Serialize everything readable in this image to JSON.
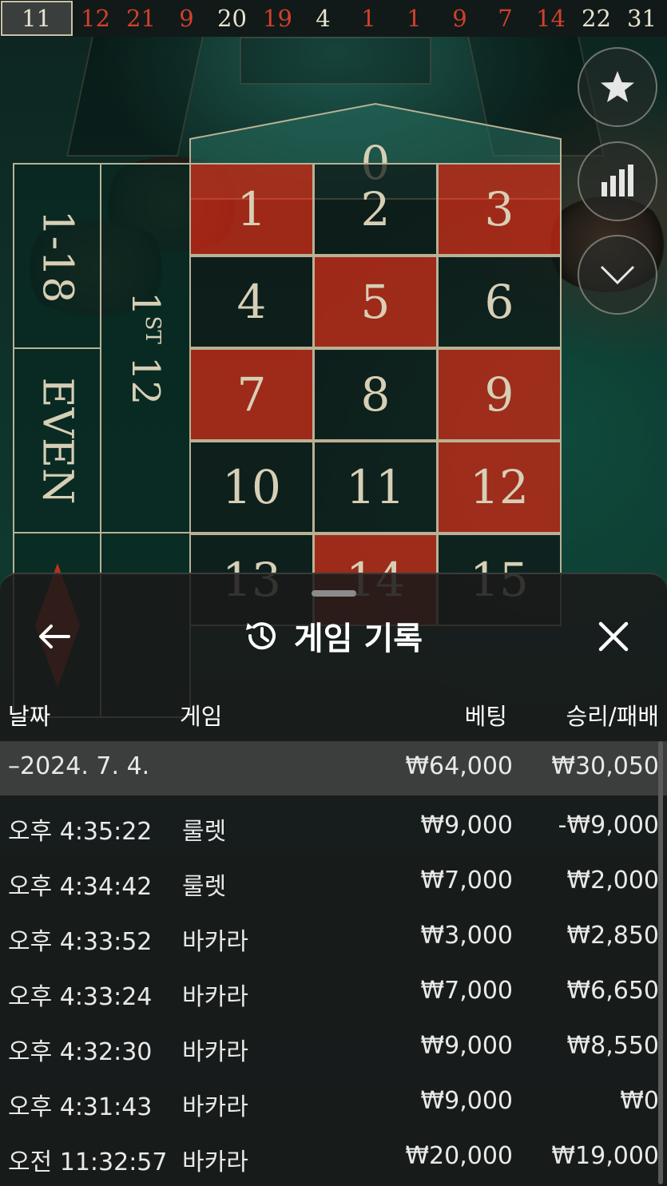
{
  "results": {
    "numbers": [
      {
        "value": "11",
        "color": "black"
      },
      {
        "value": "12",
        "color": "red"
      },
      {
        "value": "21",
        "color": "red"
      },
      {
        "value": "9",
        "color": "red"
      },
      {
        "value": "20",
        "color": "black"
      },
      {
        "value": "19",
        "color": "red"
      },
      {
        "value": "4",
        "color": "black"
      },
      {
        "value": "1",
        "color": "red"
      },
      {
        "value": "1",
        "color": "red"
      },
      {
        "value": "9",
        "color": "red"
      },
      {
        "value": "7",
        "color": "red"
      },
      {
        "value": "14",
        "color": "red"
      },
      {
        "value": "22",
        "color": "black"
      },
      {
        "value": "31",
        "color": "black"
      }
    ]
  },
  "table": {
    "zero": "0",
    "cells": [
      {
        "n": "1",
        "color": "red"
      },
      {
        "n": "2",
        "color": "black"
      },
      {
        "n": "3",
        "color": "red"
      },
      {
        "n": "4",
        "color": "black"
      },
      {
        "n": "5",
        "color": "red"
      },
      {
        "n": "6",
        "color": "black"
      },
      {
        "n": "7",
        "color": "red"
      },
      {
        "n": "8",
        "color": "black"
      },
      {
        "n": "9",
        "color": "red"
      },
      {
        "n": "10",
        "color": "black"
      },
      {
        "n": "11",
        "color": "black"
      },
      {
        "n": "12",
        "color": "red"
      },
      {
        "n": "13",
        "color": "black"
      },
      {
        "n": "14",
        "color": "red"
      },
      {
        "n": "15",
        "color": "black"
      }
    ],
    "outside": {
      "low": "1-18",
      "even": "EVEN",
      "dozen_num": "1",
      "dozen_sup": "ST",
      "dozen_word": "12"
    },
    "colors": {
      "red": "#c0341f",
      "black": "#131c1a",
      "felt": "#0b3b31",
      "line": "#b9b194"
    }
  },
  "side_buttons": {
    "favorite_icon": "star-icon",
    "stats_icon": "bar-chart-icon",
    "collapse_icon": "chevron-down-icon"
  },
  "history": {
    "title": "게임 기록",
    "title_icon": "history-clock-icon",
    "back_icon": "arrow-left-icon",
    "close_icon": "close-icon",
    "columns": {
      "date": "날짜",
      "game": "게임",
      "bet": "베팅",
      "result": "승리/패배"
    },
    "day": {
      "date": "–2024. 7. 4.",
      "bet": "₩64,000",
      "result": "₩30,050"
    },
    "rows": [
      {
        "time": "오후 4:35:22",
        "game": "룰렛",
        "bet": "₩9,000",
        "result": "-₩9,000"
      },
      {
        "time": "오후 4:34:42",
        "game": "룰렛",
        "bet": "₩7,000",
        "result": "₩2,000"
      },
      {
        "time": "오후 4:33:52",
        "game": "바카라",
        "bet": "₩3,000",
        "result": "₩2,850"
      },
      {
        "time": "오후 4:33:24",
        "game": "바카라",
        "bet": "₩7,000",
        "result": "₩6,650"
      },
      {
        "time": "오후 4:32:30",
        "game": "바카라",
        "bet": "₩9,000",
        "result": "₩8,550"
      },
      {
        "time": "오후 4:31:43",
        "game": "바카라",
        "bet": "₩9,000",
        "result": "₩0"
      },
      {
        "time": "오전 11:32:57",
        "game": "바카라",
        "bet": "₩20,000",
        "result": "₩19,000"
      }
    ]
  }
}
